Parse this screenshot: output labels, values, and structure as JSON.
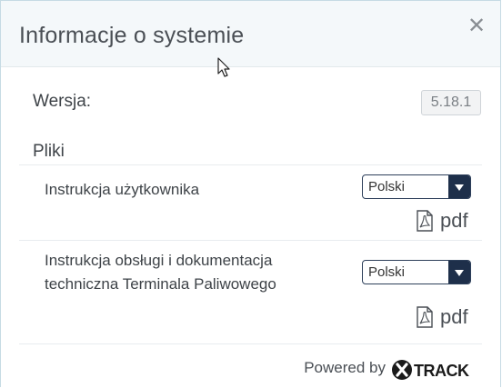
{
  "dialog": {
    "title": "Informacje o systemie",
    "close_glyph": "✕"
  },
  "version": {
    "label": "Wersja:",
    "value": "5.18.1"
  },
  "files": {
    "label": "Pliki",
    "items": [
      {
        "name": "Instrukcja użytkownika",
        "language": "Polski",
        "link_label": "pdf"
      },
      {
        "name_line1": "Instrukcja obsługi i dokumentacja",
        "name_line2": "techniczna Terminala Paliwowego",
        "language": "Polski",
        "link_label": "pdf"
      }
    ]
  },
  "footer": {
    "powered_by": "Powered by",
    "brand": "XTRACK",
    "brand_color": "#1a1a1a"
  },
  "icons": {
    "close": "close-icon",
    "pdf": "pdf-file-icon",
    "dropdown": "chevron-down-icon",
    "cursor": "mouse-pointer-icon"
  }
}
